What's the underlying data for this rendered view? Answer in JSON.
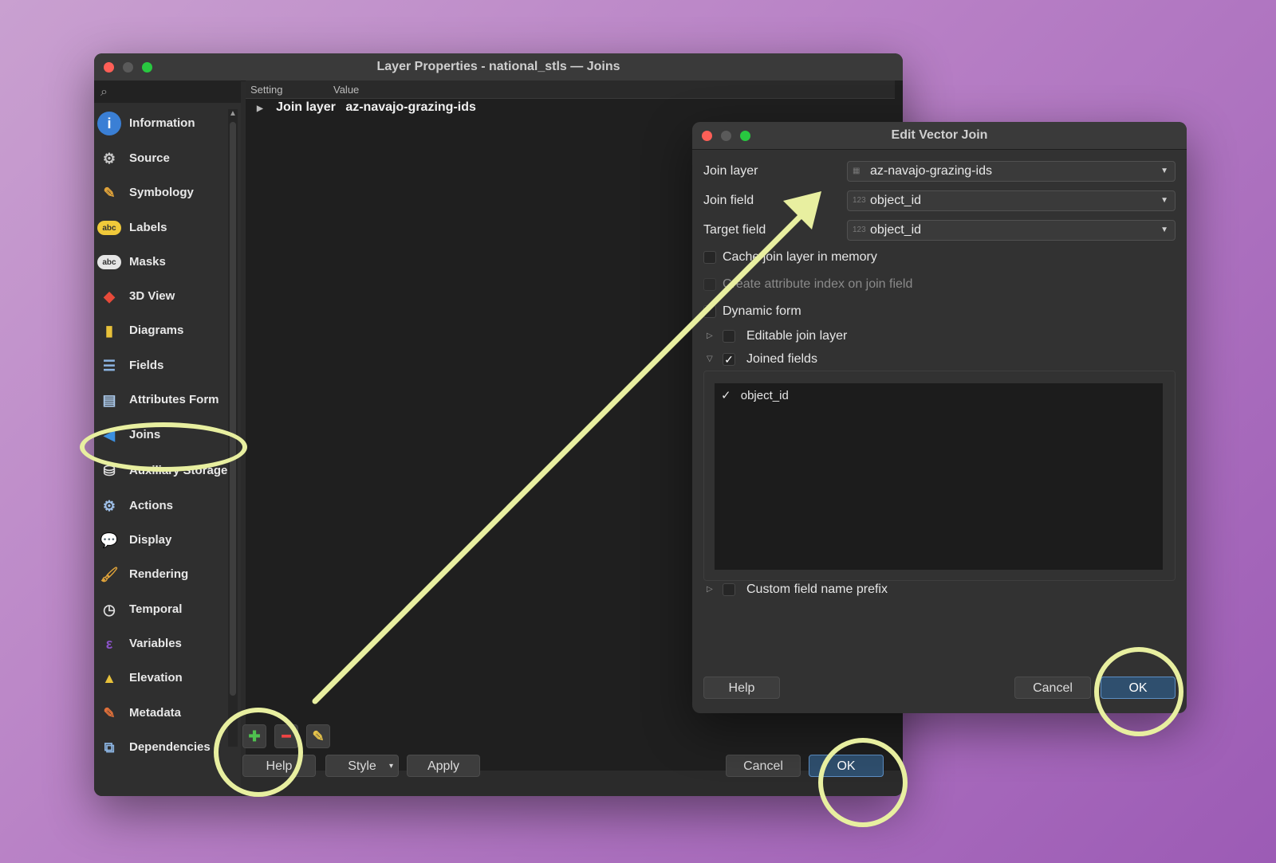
{
  "main_window": {
    "title": "Layer Properties - national_stls — Joins",
    "sidebar": [
      {
        "label": "Information",
        "icon": "info-icon",
        "glyph": "i"
      },
      {
        "label": "Source",
        "icon": "source-icon",
        "glyph": "⚙"
      },
      {
        "label": "Symbology",
        "icon": "symbology-icon",
        "glyph": "✎"
      },
      {
        "label": "Labels",
        "icon": "labels-icon",
        "glyph": "abc"
      },
      {
        "label": "Masks",
        "icon": "masks-icon",
        "glyph": "abc"
      },
      {
        "label": "3D View",
        "icon": "cube-icon",
        "glyph": "◆"
      },
      {
        "label": "Diagrams",
        "icon": "diagrams-icon",
        "glyph": "▮"
      },
      {
        "label": "Fields",
        "icon": "fields-icon",
        "glyph": "☰"
      },
      {
        "label": "Attributes Form",
        "icon": "form-icon",
        "glyph": "▤"
      },
      {
        "label": "Joins",
        "icon": "joins-icon",
        "glyph": "◀"
      },
      {
        "label": "Auxiliary Storage",
        "icon": "storage-icon",
        "glyph": "⛁"
      },
      {
        "label": "Actions",
        "icon": "actions-icon",
        "glyph": "⚙"
      },
      {
        "label": "Display",
        "icon": "display-icon",
        "glyph": "💬"
      },
      {
        "label": "Rendering",
        "icon": "rendering-icon",
        "glyph": "🖌"
      },
      {
        "label": "Temporal",
        "icon": "clock-icon",
        "glyph": "◷"
      },
      {
        "label": "Variables",
        "icon": "variables-icon",
        "glyph": "ε"
      },
      {
        "label": "Elevation",
        "icon": "elevation-icon",
        "glyph": "▲"
      },
      {
        "label": "Metadata",
        "icon": "metadata-icon",
        "glyph": "✎"
      },
      {
        "label": "Dependencies",
        "icon": "dependencies-icon",
        "glyph": "⧉"
      }
    ],
    "columns": {
      "setting": "Setting",
      "value": "Value"
    },
    "join_row": {
      "setting": "Join layer",
      "value": "az-navajo-grazing-ids"
    },
    "buttons": {
      "help": "Help",
      "style": "Style",
      "apply": "Apply",
      "cancel": "Cancel",
      "ok": "OK"
    },
    "tool_icons": {
      "add": "plus-icon",
      "remove": "minus-icon",
      "edit": "pencil-icon"
    }
  },
  "dialog": {
    "title": "Edit Vector Join",
    "join_layer_label": "Join layer",
    "join_layer_value": "az-navajo-grazing-ids",
    "join_field_label": "Join field",
    "join_field_value": "object_id",
    "target_field_label": "Target field",
    "target_field_value": "object_id",
    "type_badge": "123",
    "cache_label": "Cache join layer in memory",
    "index_label": "Create attribute index on join field",
    "dynamic_label": "Dynamic form",
    "editable_label": "Editable join layer",
    "joined_fields_label": "Joined fields",
    "joined_fields": [
      "object_id"
    ],
    "prefix_label": "Custom field name prefix",
    "buttons": {
      "help": "Help",
      "cancel": "Cancel",
      "ok": "OK"
    }
  },
  "annotation_color": "#e8efa0"
}
